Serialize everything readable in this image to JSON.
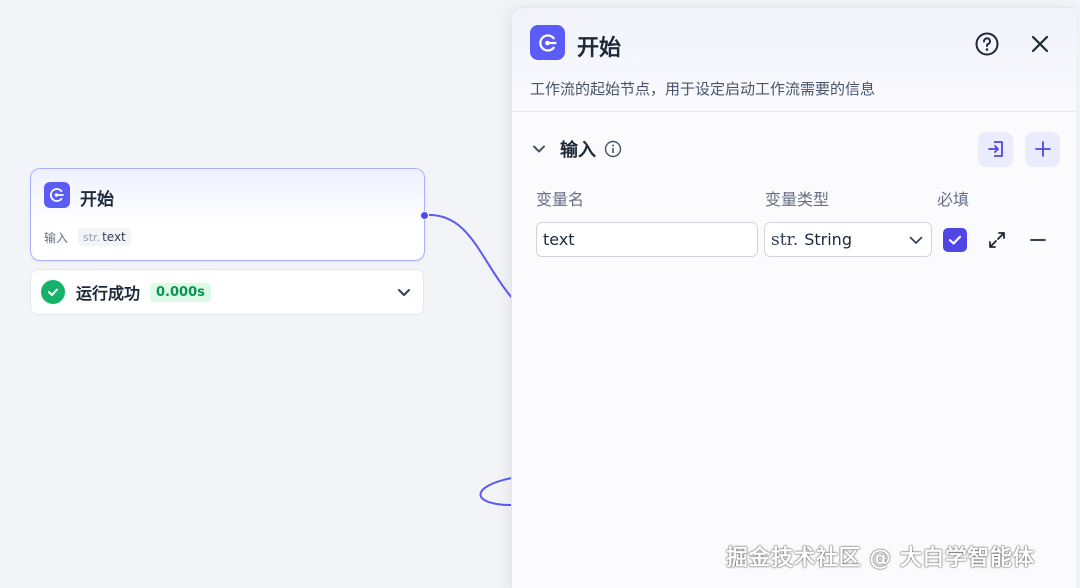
{
  "node": {
    "title": "开始",
    "input_label": "输入",
    "variable": {
      "type_prefix": "str.",
      "name": "text"
    }
  },
  "run_status": {
    "label": "运行成功",
    "duration": "0.000s",
    "color": "#17b26a"
  },
  "panel": {
    "title": "开始",
    "description": "工作流的起始节点，用于设定启动工作流需要的信息",
    "section": {
      "title": "输入",
      "columns": {
        "name": "变量名",
        "type": "变量类型",
        "required": "必填"
      },
      "variables": [
        {
          "name": "text",
          "type_prefix": "str.",
          "type": "String",
          "required": true
        }
      ]
    }
  },
  "colors": {
    "accent": "#5b5bf6",
    "success": "#17b26a",
    "edge": "#5b5bf6"
  },
  "icons": [
    "start-node-icon",
    "check-circle-icon",
    "chevron-down-icon",
    "help-icon",
    "close-icon",
    "info-icon",
    "import-icon",
    "plus-icon",
    "checkbox-checked-icon",
    "expand-icon",
    "minus-icon"
  ],
  "watermark": "掘金技术社区 @ 大白学智能体"
}
